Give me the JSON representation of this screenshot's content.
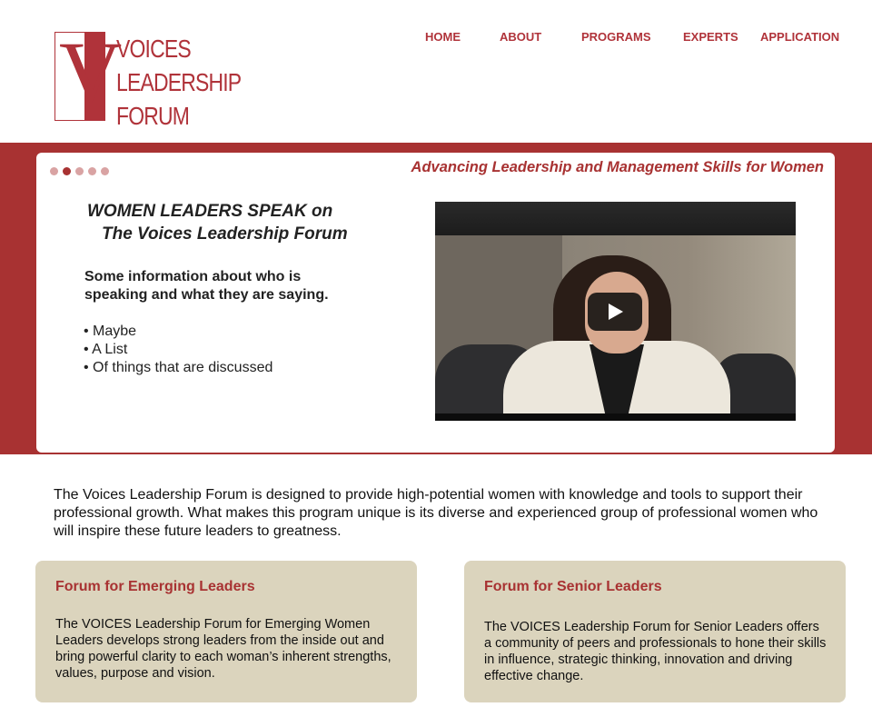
{
  "brand": {
    "logo_letter": "V",
    "logo_lines": [
      "VOICES",
      "LEADERSHIP",
      "FORUM"
    ]
  },
  "nav": {
    "items": [
      "HOME",
      "ABOUT",
      "PROGRAMS",
      "EXPERTS",
      "APPLICATION"
    ]
  },
  "hero": {
    "tagline": "Advancing Leadership and Management Skills for Women",
    "slide_count": 5,
    "active_slide": 2,
    "title_line1": "WOMEN LEADERS SPEAK on",
    "title_line2": "The Voices Leadership Forum",
    "info": "Some information about who is speaking and what they are saying.",
    "list": [
      "Maybe",
      "A List",
      "Of things that are discussed"
    ]
  },
  "intro": "The Voices Leadership Forum is designed to provide high-potential women with knowledge and tools to support their professional growth. What makes this program unique is its diverse and experienced group of professional women who will inspire these future leaders to greatness.",
  "cards": [
    {
      "title": "Forum for Emerging Leaders",
      "body": "The VOICES Leadership Forum for Emerging Women Leaders develops strong leaders from the inside out and bring powerful clarity to each woman’s inherent strengths, values, purpose and vision."
    },
    {
      "title": "Forum for Senior Leaders",
      "body": "The VOICES Leadership Forum for Senior Leaders offers a community of peers and professionals to hone their skills in influence, strategic thinking, innovation and driving effective change."
    }
  ],
  "colors": {
    "brand_red": "#a83232",
    "card_beige": "#dbd4bd"
  }
}
